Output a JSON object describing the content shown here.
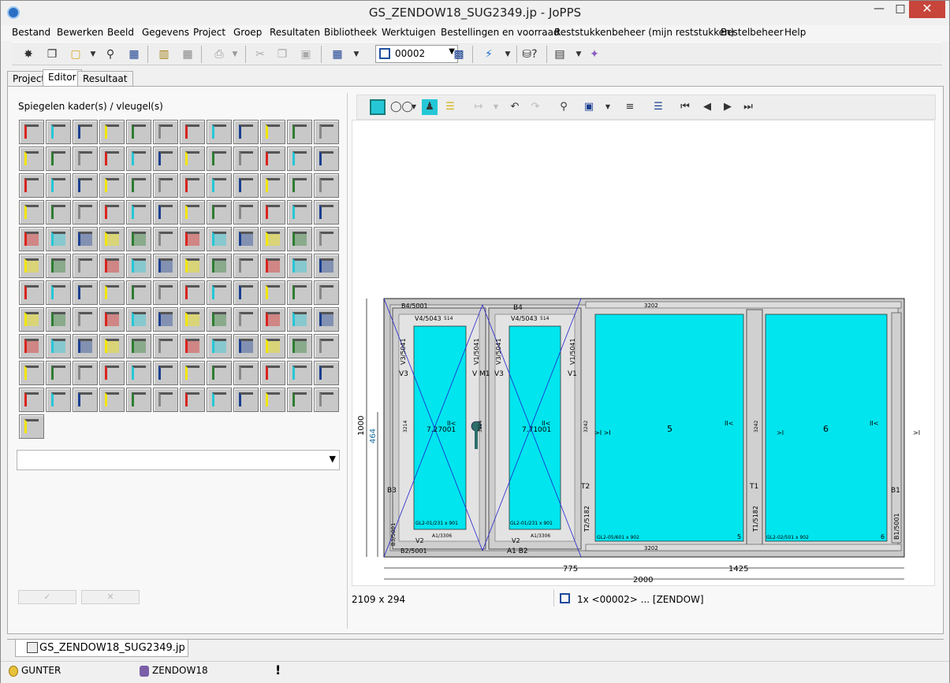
{
  "window": {
    "title": "GS_ZENDOW18_SUG2349.jp - JoPPS"
  },
  "menu": [
    "Bestand",
    "Bewerken",
    "Beeld",
    "Gegevens",
    "Project",
    "Groep",
    "Resultaten",
    "Bibliotheek",
    "Werktuigen",
    "Bestellingen en voorraad",
    "Reststukkenbeheer (mijn reststukken)",
    "Bestelbeheer",
    "Help"
  ],
  "toolbar": {
    "combo_value": "00002"
  },
  "tabs": [
    "Project",
    "Editor",
    "Resultaat"
  ],
  "editor": {
    "left_title": "Spiegelen kader(s) / vleugel(s)",
    "size_text": "2109 x 294",
    "selection_text": "1x <00002> ... [ZENDOW]"
  },
  "drawing": {
    "dim_total_height": "1000",
    "dim_handle": "464",
    "dim_width_left": "775",
    "dim_width_right": "1425",
    "dim_width_total": "2000",
    "frame_top_profile": "3202",
    "frame_bottom_profile": "3202",
    "labels": {
      "b4_left": "B4/5001",
      "b4_mid": "B4",
      "v4_1": "V4/5043",
      "v4_2": "V4/5043",
      "p514_1": "514",
      "p514_2": "514",
      "v3_left_profile": "V3/5041",
      "v1_left_profile": "V1/5041",
      "v3_right_profile": "V3/5041",
      "v1_right_profile": "V1/5041",
      "v3_a": "V3",
      "v1m1": "V M1",
      "v3_b": "V3",
      "v1_b": "V1",
      "p3214_a": "3214",
      "p3214_b": "3214",
      "p3242_a": "3242",
      "p3242_b": "3242",
      "sash1": "7.27001",
      "sash2": "7.71001",
      "field5": "5",
      "field6": "6",
      "b3": "B3",
      "b1": "B1",
      "t2": "T2",
      "t1": "T1",
      "t2_profile": "T2/5182",
      "t1_profile": "T1/5182",
      "b3_profile": "B3/5001",
      "b1_profile": "B1/5001",
      "gl1": "GL2-01/231 x 901",
      "gl2": "GL2-01/231 x 901",
      "gl5": "GL2-05/601 x 902",
      "gl6": "GL2-02/501 x 902",
      "a1_1": "A1/3306",
      "a1_2": "A1/3306",
      "v2_1": "V2",
      "v2_2": "V2",
      "b2": "B2/5001",
      "a1_b2": "A1 B2",
      "num5": "5",
      "num6": "6",
      "mark_ii": "II<",
      "mark_gt": ">I",
      "mark_gtgt": ">I >I"
    }
  },
  "bottom": {
    "file_tab": "GS_ZENDOW18_SUG2349.jp"
  },
  "status": {
    "user": "GUNTER",
    "db": "ZENDOW18"
  }
}
